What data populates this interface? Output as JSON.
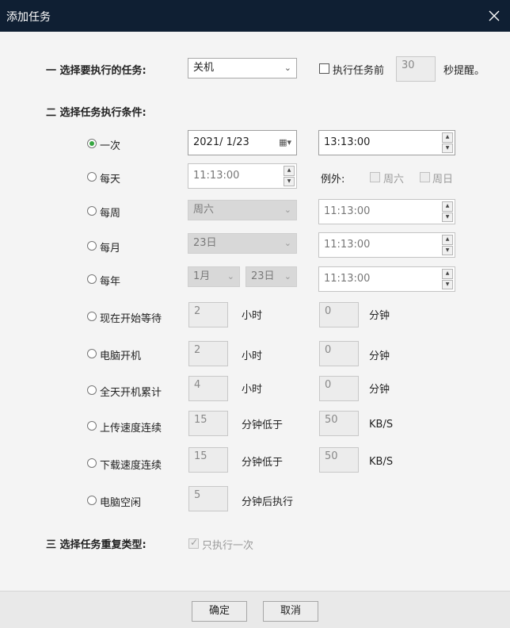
{
  "window": {
    "title": "添加任务"
  },
  "sections": {
    "task": "一 选择要执行的任务:",
    "condition": "二 选择任务执行条件:",
    "repeat": "三 选择任务重复类型:"
  },
  "task_select": {
    "value": "关机"
  },
  "remind": {
    "before_label": "执行任务前",
    "seconds": "30",
    "after_label": "秒提醒。"
  },
  "conditions": {
    "once": {
      "label": "一次",
      "date": "2021/  1/23",
      "time": "13:13:00"
    },
    "daily": {
      "label": "每天",
      "time": "11:13:00",
      "exception_label": "例外:",
      "sat": "周六",
      "sun": "周日"
    },
    "weekly": {
      "label": "每周",
      "day": "周六",
      "time": "11:13:00"
    },
    "monthly": {
      "label": "每月",
      "day": "23日",
      "time": "11:13:00"
    },
    "yearly": {
      "label": "每年",
      "month": "1月",
      "day": "23日",
      "time": "11:13:00"
    },
    "wait": {
      "label": "现在开始等待",
      "hours": "2",
      "hours_unit": "小时",
      "minutes": "0",
      "minutes_unit": "分钟"
    },
    "boot": {
      "label": "电脑开机",
      "hours": "2",
      "hours_unit": "小时",
      "minutes": "0",
      "minutes_unit": "分钟"
    },
    "uptime": {
      "label": "全天开机累计",
      "hours": "4",
      "hours_unit": "小时",
      "minutes": "0",
      "minutes_unit": "分钟"
    },
    "upload": {
      "label": "上传速度连续",
      "minutes": "15",
      "mid_label": "分钟低于",
      "speed": "50",
      "unit": "KB/S"
    },
    "download": {
      "label": "下载速度连续",
      "minutes": "15",
      "mid_label": "分钟低于",
      "speed": "50",
      "unit": "KB/S"
    },
    "idle": {
      "label": "电脑空闲",
      "minutes": "5",
      "after_label": "分钟后执行"
    }
  },
  "repeat": {
    "once_label": "只执行一次"
  },
  "buttons": {
    "ok": "确定",
    "cancel": "取消"
  },
  "colors": {
    "titlebar": "#0f1f33",
    "radio_selected": "#36a640"
  }
}
